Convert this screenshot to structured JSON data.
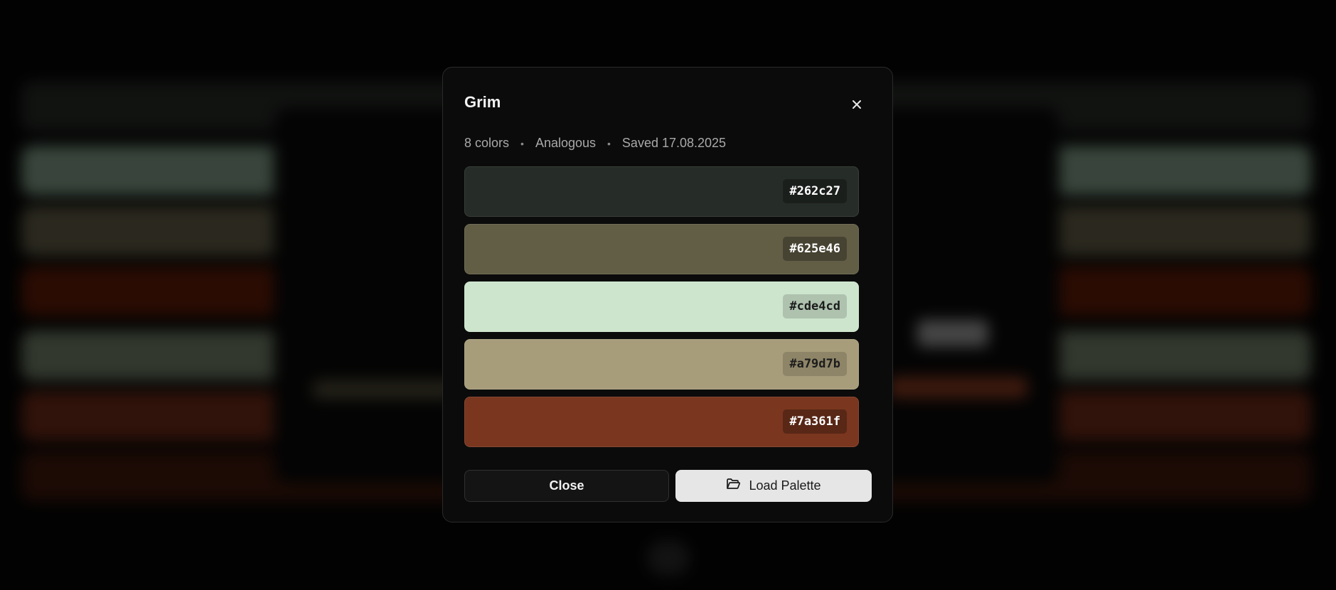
{
  "modal": {
    "title": "Grim",
    "meta": {
      "count": "8 colors",
      "harmony": "Analogous",
      "saved": "Saved 17.08.2025",
      "separator": "•"
    },
    "swatches": [
      {
        "hex": "#262c27",
        "color": "#262c27",
        "text_tone": "light"
      },
      {
        "hex": "#625e46",
        "color": "#625e46",
        "text_tone": "light"
      },
      {
        "hex": "#cde4cd",
        "color": "#cde4cd",
        "text_tone": "dark"
      },
      {
        "hex": "#a79d7b",
        "color": "#a79d7b",
        "text_tone": "dark"
      },
      {
        "hex": "#7a361f",
        "color": "#7a361f",
        "text_tone": "light"
      }
    ],
    "close_label": "Close",
    "load_label": "Load Palette",
    "icons": {
      "close": "close-icon",
      "load": "folder-open-icon"
    }
  },
  "background": {
    "band_colors": [
      "#262a26",
      "#7f9a86",
      "#605c45",
      "#5e1c08",
      "#6f7c66",
      "#6b2a18",
      "#3e180c"
    ]
  }
}
